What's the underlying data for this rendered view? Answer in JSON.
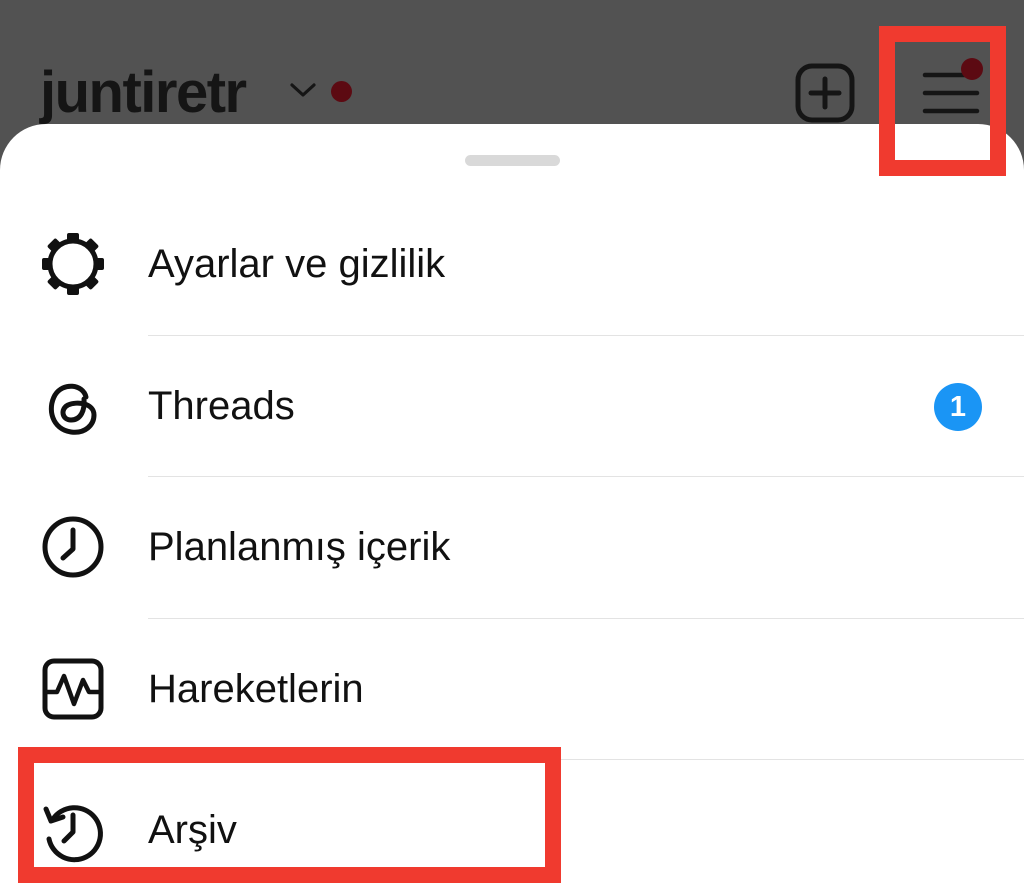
{
  "header": {
    "username": "juntiretr",
    "icons": {
      "chevron": "chevron-down-icon",
      "notification_dot": "notification-dot",
      "create": "plus-square-icon",
      "menu": "hamburger-menu-icon"
    }
  },
  "sheet": {
    "items": [
      {
        "label": "Ayarlar ve gizlilik",
        "icon": "gear-icon"
      },
      {
        "label": "Threads",
        "icon": "threads-icon",
        "badge": "1"
      },
      {
        "label": "Planlanmış içerik",
        "icon": "clock-icon"
      },
      {
        "label": "Hareketlerin",
        "icon": "activity-icon"
      },
      {
        "label": "Arşiv",
        "icon": "archive-history-icon"
      }
    ]
  },
  "colors": {
    "dim_overlay": "#525252",
    "sheet_background": "#ffffff",
    "text_primary": "#111111",
    "badge_blue": "#1a95f5",
    "notification_dot": "#5c0a12",
    "highlight_red": "#f03a2f",
    "divider": "#e3e3e3"
  }
}
